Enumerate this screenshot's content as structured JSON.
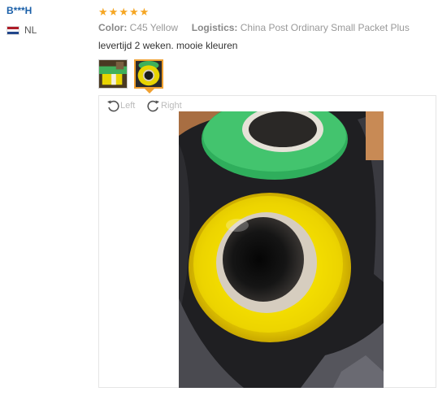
{
  "reviewer": {
    "name": "B***H",
    "country": "NL",
    "flag_colors": [
      "#ae1c28",
      "#ffffff",
      "#21468b"
    ]
  },
  "review": {
    "rating": 5,
    "rating_max": 5,
    "star_color": "#f5a623",
    "color_label": "Color:",
    "color_value": "C45 Yellow",
    "logistics_label": "Logistics:",
    "logistics_value": "China Post Ordinary Small Packet Plus",
    "text": "levertijd 2 weken. mooie kleuren"
  },
  "gallery": {
    "thumbnails": [
      {
        "name": "photo-1",
        "active": false
      },
      {
        "name": "photo-2",
        "active": true
      }
    ],
    "active_border_color": "#f0a030"
  },
  "viewer": {
    "rotate_left_label": "Left",
    "rotate_right_label": "Right",
    "rotate_left_icon": "rotate-left-icon",
    "rotate_right_icon": "rotate-right-icon"
  }
}
